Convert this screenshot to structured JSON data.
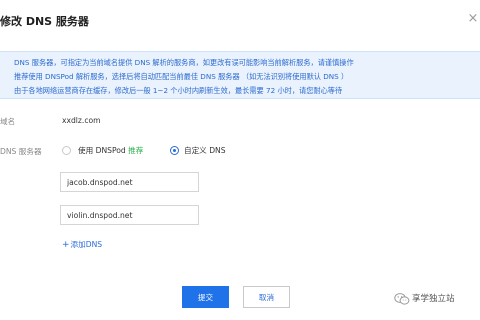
{
  "dialog": {
    "title": "修改 DNS 服务器",
    "close_symbol": "×",
    "notice": [
      "DNS 服务器，可指定为当前域名提供 DNS 解析的服务商，如更改有误可能影响当前解析服务，请谨慎操作",
      "推荐使用 DNSPod 解析服务，选择后将自动匹配当前最佳 DNS 服务器 （如无法识别将使用默认 DNS ）",
      "由于各地网络运营商存在缓存，修改后一般 1~2 个小时内刷新生效，最长需要 72 小时，请您耐心等待"
    ],
    "domain": {
      "label": "域名",
      "value": "xxdlz.com"
    },
    "dns": {
      "label": "DNS 服务器",
      "options": [
        {
          "label": "使用 DNSPod",
          "tag": "推荐",
          "checked": false
        },
        {
          "label": "自定义 DNS",
          "checked": true
        }
      ],
      "servers": [
        "jacob.dnspod.net",
        "violin.dnspod.net"
      ],
      "add_label": "添加DNS",
      "add_symbol": "+"
    },
    "buttons": {
      "submit": "提交",
      "cancel": "取消"
    },
    "colors": {
      "accent": "#1f72e8",
      "notice_bg": "#e9f2fd",
      "recommend": "#2bb24c"
    }
  },
  "watermark": {
    "text": "享学独立站",
    "icon": "wechat-icon"
  }
}
